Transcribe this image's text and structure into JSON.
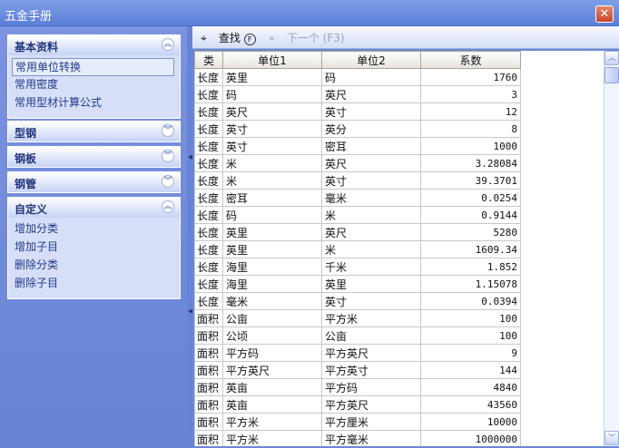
{
  "window": {
    "title": "五金手册",
    "close_glyph": "✕"
  },
  "sidebar": {
    "groups": [
      {
        "title": "基本资料",
        "expanded": true,
        "items": [
          "常用单位转换",
          "常用密度",
          "常用型材计算公式"
        ],
        "selected_index": 0
      },
      {
        "title": "型钢",
        "expanded": false,
        "items": []
      },
      {
        "title": "钢板",
        "expanded": false,
        "items": []
      },
      {
        "title": "钢管",
        "expanded": false,
        "items": []
      },
      {
        "title": "自定义",
        "expanded": true,
        "items": [
          "增加分类",
          "增加子目",
          "删除分类",
          "删除子目"
        ]
      }
    ],
    "chevron_up": "︽",
    "chevron_down": "︾"
  },
  "toolbar": {
    "find_label": "查找",
    "find_key": "F",
    "find_icon": "binoculars-icon",
    "next_label": "下一个",
    "next_key": "F3",
    "next_icon": "binoculars-next-icon"
  },
  "table": {
    "columns": [
      "类",
      "单位1",
      "单位2",
      "系数"
    ],
    "rows": [
      [
        "长度",
        "英里",
        "码",
        "1760"
      ],
      [
        "长度",
        "码",
        "英尺",
        "3"
      ],
      [
        "长度",
        "英尺",
        "英寸",
        "12"
      ],
      [
        "长度",
        "英寸",
        "英分",
        "8"
      ],
      [
        "长度",
        "英寸",
        "密耳",
        "1000"
      ],
      [
        "长度",
        "米",
        "英尺",
        "3.28084"
      ],
      [
        "长度",
        "米",
        "英寸",
        "39.3701"
      ],
      [
        "长度",
        "密耳",
        "毫米",
        "0.0254"
      ],
      [
        "长度",
        "码",
        "米",
        "0.9144"
      ],
      [
        "长度",
        "英里",
        "英尺",
        "5280"
      ],
      [
        "长度",
        "英里",
        "米",
        "1609.34"
      ],
      [
        "长度",
        "海里",
        "千米",
        "1.852"
      ],
      [
        "长度",
        "海里",
        "英里",
        "1.15078"
      ],
      [
        "长度",
        "毫米",
        "英寸",
        "0.0394"
      ],
      [
        "面积",
        "公亩",
        "平方米",
        "100"
      ],
      [
        "面积",
        "公顷",
        "公亩",
        "100"
      ],
      [
        "面积",
        "平方码",
        "平方英尺",
        "9"
      ],
      [
        "面积",
        "平方英尺",
        "平方英寸",
        "144"
      ],
      [
        "面积",
        "英亩",
        "平方码",
        "4840"
      ],
      [
        "面积",
        "英亩",
        "平方英尺",
        "43560"
      ],
      [
        "面积",
        "平方米",
        "平方厘米",
        "10000"
      ],
      [
        "面积",
        "平方米",
        "平方毫米",
        "1000000"
      ]
    ]
  },
  "scrollbar": {
    "up_glyph": "︿",
    "down_glyph": "﹀"
  }
}
